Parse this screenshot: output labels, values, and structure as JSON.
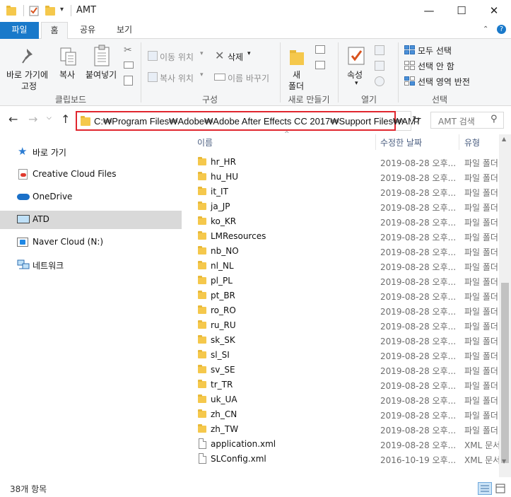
{
  "window": {
    "title": "AMT",
    "minimize": "—",
    "maximize": "☐",
    "close": "✕"
  },
  "ribbon_tabs": [
    "파일",
    "홈",
    "공유",
    "보기"
  ],
  "ribbon": {
    "clipboard": {
      "pin_label_1": "바로 가기에",
      "pin_label_2": "고정",
      "copy": "복사",
      "paste": "붙여넣기",
      "group": "클립보드"
    },
    "organize": {
      "move_to": "이동 위치",
      "copy_to": "복사 위치",
      "delete": "삭제",
      "rename": "이름 바꾸기",
      "group": "구성"
    },
    "new": {
      "new_folder_1": "새",
      "new_folder_2": "폴더",
      "group": "새로 만들기"
    },
    "open": {
      "properties": "속성",
      "group": "열기"
    },
    "select": {
      "select_all": "모두 선택",
      "select_none": "선택 안 함",
      "invert": "선택 영역 반전",
      "group": "선택"
    }
  },
  "address": {
    "path": "C:₩Program Files₩Adobe₩Adobe After Effects CC 2017₩Support Files₩AMT",
    "search_placeholder": "AMT 검색"
  },
  "nav_items": [
    {
      "label": "바로 가기",
      "icon": "star-icon"
    },
    {
      "label": "Creative Cloud Files",
      "icon": "creative-cloud-icon"
    },
    {
      "label": "OneDrive",
      "icon": "cloud-icon"
    },
    {
      "label": "ATD",
      "icon": "computer-icon",
      "selected": true
    },
    {
      "label": "Naver Cloud (N:)",
      "icon": "drive-icon"
    },
    {
      "label": "네트워크",
      "icon": "network-icon"
    }
  ],
  "columns": {
    "name": "이름",
    "date": "수정한 날짜",
    "type": "유형"
  },
  "files": [
    {
      "name": "hr_HR",
      "date": "2019-08-28 오후...",
      "type": "파일 폴더",
      "kind": "folder"
    },
    {
      "name": "hu_HU",
      "date": "2019-08-28 오후...",
      "type": "파일 폴더",
      "kind": "folder"
    },
    {
      "name": "it_IT",
      "date": "2019-08-28 오후...",
      "type": "파일 폴더",
      "kind": "folder"
    },
    {
      "name": "ja_JP",
      "date": "2019-08-28 오후...",
      "type": "파일 폴더",
      "kind": "folder"
    },
    {
      "name": "ko_KR",
      "date": "2019-08-28 오후...",
      "type": "파일 폴더",
      "kind": "folder"
    },
    {
      "name": "LMResources",
      "date": "2019-08-28 오후...",
      "type": "파일 폴더",
      "kind": "folder"
    },
    {
      "name": "nb_NO",
      "date": "2019-08-28 오후...",
      "type": "파일 폴더",
      "kind": "folder"
    },
    {
      "name": "nl_NL",
      "date": "2019-08-28 오후...",
      "type": "파일 폴더",
      "kind": "folder"
    },
    {
      "name": "pl_PL",
      "date": "2019-08-28 오후...",
      "type": "파일 폴더",
      "kind": "folder"
    },
    {
      "name": "pt_BR",
      "date": "2019-08-28 오후...",
      "type": "파일 폴더",
      "kind": "folder"
    },
    {
      "name": "ro_RO",
      "date": "2019-08-28 오후...",
      "type": "파일 폴더",
      "kind": "folder"
    },
    {
      "name": "ru_RU",
      "date": "2019-08-28 오후...",
      "type": "파일 폴더",
      "kind": "folder"
    },
    {
      "name": "sk_SK",
      "date": "2019-08-28 오후...",
      "type": "파일 폴더",
      "kind": "folder"
    },
    {
      "name": "sl_SI",
      "date": "2019-08-28 오후...",
      "type": "파일 폴더",
      "kind": "folder"
    },
    {
      "name": "sv_SE",
      "date": "2019-08-28 오후...",
      "type": "파일 폴더",
      "kind": "folder"
    },
    {
      "name": "tr_TR",
      "date": "2019-08-28 오후...",
      "type": "파일 폴더",
      "kind": "folder"
    },
    {
      "name": "uk_UA",
      "date": "2019-08-28 오후...",
      "type": "파일 폴더",
      "kind": "folder"
    },
    {
      "name": "zh_CN",
      "date": "2019-08-28 오후...",
      "type": "파일 폴더",
      "kind": "folder"
    },
    {
      "name": "zh_TW",
      "date": "2019-08-28 오후...",
      "type": "파일 폴더",
      "kind": "folder"
    },
    {
      "name": "application.xml",
      "date": "2019-08-28 오후...",
      "type": "XML 문서",
      "kind": "xml"
    },
    {
      "name": "SLConfig.xml",
      "date": "2016-10-19 오후...",
      "type": "XML 문서",
      "kind": "xml"
    }
  ],
  "status": {
    "count": "38개 항목"
  },
  "colors": {
    "file_tab": "#1979ca",
    "highlight_border": "#e0262e",
    "folder": "#f5c84c"
  }
}
